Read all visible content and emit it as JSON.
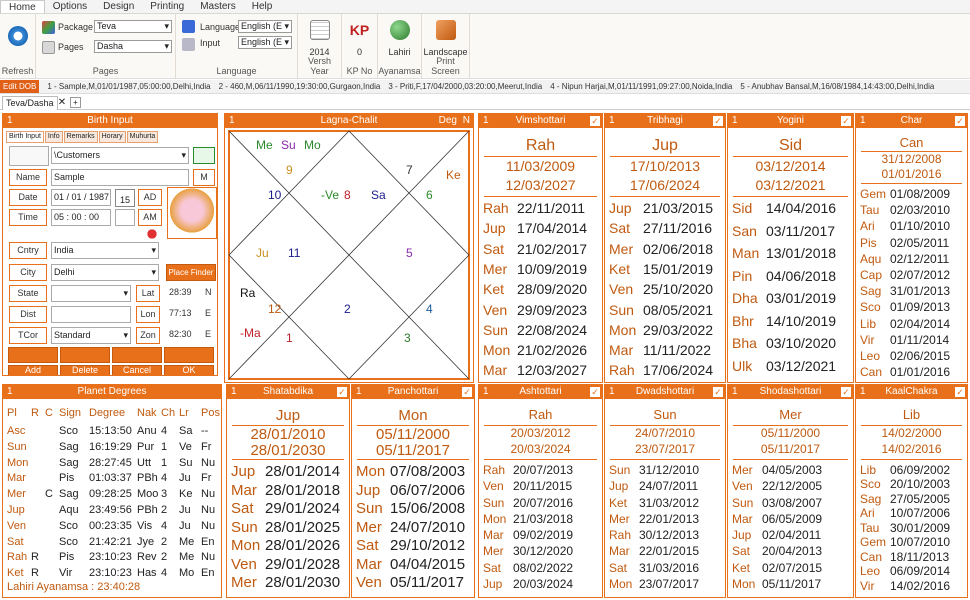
{
  "menu": [
    "Home",
    "Options",
    "Design",
    "Printing",
    "Masters",
    "Help"
  ],
  "ribbon": {
    "refresh": "Refresh",
    "package_label": "Package",
    "package_value": "Teva",
    "pages_label": "Pages",
    "pages_value": "Dasha",
    "pages_group": "Pages",
    "language_label": "Language",
    "language_value": "English (E",
    "input_label": "Input",
    "input_value": "English (E",
    "language_group": "Language",
    "versh_value": "2014",
    "versh_label": "Versh Year",
    "kp_value": "0",
    "kp_label": "KP No",
    "ayanamsa_value": "Lahiri",
    "ayanamsa_label": "Ayanamsa",
    "print_value": "Landscape",
    "print_label": "Print Screen"
  },
  "strip": {
    "edit": "Edit DOB",
    "items": [
      "1 - Sample,M,01/01/1987,05:00:00,Delhi,India",
      "2 - 460,M,06/11/1990,19:30:00,Gurgaon,India",
      "3 - Priti,F,17/04/2000,03:20:00,Meerut,India",
      "4 - Nipun Harjai,M,01/11/1991,09:27:00,Noida,India",
      "5 - Anubhav Bansal,M,16/08/1984,14:43:00,Delhi,India"
    ]
  },
  "tab": {
    "label": "Teva/Dasha",
    "close": "✕",
    "add": "+"
  },
  "birth": {
    "num": "1",
    "title": "Birth Input",
    "subtabs": [
      "Birth Input",
      "Info",
      "Remarks",
      "Horary",
      "Muhurta"
    ],
    "folder": "\\Customers",
    "name_label": "Name",
    "name": "Sample",
    "m": "M",
    "date_label": "Date",
    "date": "01 / 01 / 1987",
    "ad": "AD",
    "time_label": "Time",
    "time": "05 : 00 : 00",
    "am": "AM",
    "cntry_label": "Cntry",
    "cntry": "India",
    "city_label": "City",
    "city": "Delhi",
    "place_finder": "Place Finder",
    "state_label": "State",
    "lat_label": "Lat",
    "lat": "28:39",
    "lat_dir": "N",
    "dist_label": "Dist",
    "lon_label": "Lon",
    "lon": "77:13",
    "lon_dir": "E",
    "tcor_label": "TCor",
    "tcor": "Standard",
    "zon_label": "Zon",
    "zon": "82:30",
    "zon_dir": "E",
    "buttons": [
      "Add",
      "Delete",
      "Cancel",
      "OK"
    ],
    "cal_day": "15"
  },
  "chart": {
    "num": "1",
    "title": "Lagna-Chalit",
    "deg": "Deg",
    "n": "N",
    "labels": [
      {
        "t": "Me",
        "c": "#2a8a2a"
      },
      {
        "t": "Su",
        "c": "#8a2aa8"
      },
      {
        "t": "Mo",
        "c": "#2a8a2a"
      },
      {
        "t": "9",
        "c": "#c89020"
      },
      {
        "t": "7",
        "c": "#333"
      },
      {
        "t": "Ke",
        "c": "#c05a10"
      },
      {
        "t": "10",
        "c": "#1a1a8a"
      },
      {
        "t": "-Ve",
        "c": "#2a8a2a"
      },
      {
        "t": "8",
        "c": "#c0202a"
      },
      {
        "t": "Sa",
        "c": "#1a1a8a"
      },
      {
        "t": "6",
        "c": "#2a8a2a"
      },
      {
        "t": "Ju",
        "c": "#c89020"
      },
      {
        "t": "11",
        "c": "#1a1a8a"
      },
      {
        "t": "5",
        "c": "#8a2aa8"
      },
      {
        "t": "Ra",
        "c": "#111"
      },
      {
        "t": "12",
        "c": "#c05a10"
      },
      {
        "t": "2",
        "c": "#1a1a8a"
      },
      {
        "t": "4",
        "c": "#1a5a9a"
      },
      {
        "t": "-Ma",
        "c": "#c0202a"
      },
      {
        "t": "1",
        "c": "#c0202a"
      },
      {
        "t": "3",
        "c": "#2a7a2a"
      }
    ]
  },
  "top_dashas": [
    {
      "num": "1",
      "title": "Vimshottari",
      "head": "Rah",
      "d1": "11/03/2009",
      "d2": "12/03/2027",
      "rows": [
        [
          "Rah",
          "22/11/2011"
        ],
        [
          "Jup",
          "17/04/2014"
        ],
        [
          "Sat",
          "21/02/2017"
        ],
        [
          "Mer",
          "10/09/2019"
        ],
        [
          "Ket",
          "28/09/2020"
        ],
        [
          "Ven",
          "29/09/2023"
        ],
        [
          "Sun",
          "22/08/2024"
        ],
        [
          "Mon",
          "21/02/2026"
        ],
        [
          "Mar",
          "12/03/2027"
        ]
      ]
    },
    {
      "num": "1",
      "title": "Tribhagi",
      "head": "Jup",
      "d1": "17/10/2013",
      "d2": "17/06/2024",
      "rows": [
        [
          "Jup",
          "21/03/2015"
        ],
        [
          "Sat",
          "27/11/2016"
        ],
        [
          "Mer",
          "02/06/2018"
        ],
        [
          "Ket",
          "15/01/2019"
        ],
        [
          "Ven",
          "25/10/2020"
        ],
        [
          "Sun",
          "08/05/2021"
        ],
        [
          "Mon",
          "29/03/2022"
        ],
        [
          "Mar",
          "11/11/2022"
        ],
        [
          "Rah",
          "17/06/2024"
        ]
      ]
    },
    {
      "num": "1",
      "title": "Yogini",
      "head": "Sid",
      "d1": "03/12/2014",
      "d2": "03/12/2021",
      "rows": [
        [
          "Sid",
          "14/04/2016"
        ],
        [
          "San",
          "03/11/2017"
        ],
        [
          "Man",
          "13/01/2018"
        ],
        [
          "Pin",
          "04/06/2018"
        ],
        [
          "Dha",
          "03/01/2019"
        ],
        [
          "Bhr",
          "14/10/2019"
        ],
        [
          "Bha",
          "03/10/2020"
        ],
        [
          "Ulk",
          "03/12/2021"
        ]
      ]
    }
  ],
  "char": {
    "num": "1",
    "title": "Char",
    "head": "Can",
    "d1": "31/12/2008",
    "d2": "01/01/2016",
    "rows": [
      [
        "Gem",
        "01/08/2009"
      ],
      [
        "Tau",
        "02/03/2010"
      ],
      [
        "Ari",
        "01/10/2010"
      ],
      [
        "Pis",
        "02/05/2011"
      ],
      [
        "Aqu",
        "02/12/2011"
      ],
      [
        "Cap",
        "02/07/2012"
      ],
      [
        "Sag",
        "31/01/2013"
      ],
      [
        "Sco",
        "01/09/2013"
      ],
      [
        "Lib",
        "02/04/2014"
      ],
      [
        "Vir",
        "01/11/2014"
      ],
      [
        "Leo",
        "02/06/2015"
      ],
      [
        "Can",
        "01/01/2016"
      ]
    ]
  },
  "planets": {
    "num": "1",
    "title": "Planet Degrees",
    "headers": [
      "Pl",
      "R",
      "C",
      "Sign",
      "Degree",
      "Nak",
      "Ch",
      "Lr",
      "Pos"
    ],
    "rows": [
      [
        "Asc",
        "",
        "",
        "Sco",
        "15:13:50",
        "Anu",
        "4",
        "Sa",
        "--"
      ],
      [
        "Sun",
        "",
        "",
        "Sag",
        "16:19:29",
        "Pur",
        "1",
        "Ve",
        "Fr"
      ],
      [
        "Mon",
        "",
        "",
        "Sag",
        "28:27:45",
        "Utt",
        "1",
        "Su",
        "Nu"
      ],
      [
        "Mar",
        "",
        "",
        "Pis",
        "01:03:37",
        "PBh",
        "4",
        "Ju",
        "Fr"
      ],
      [
        "Mer",
        "",
        "C",
        "Sag",
        "09:28:25",
        "Moo",
        "3",
        "Ke",
        "Nu"
      ],
      [
        "Jup",
        "",
        "",
        "Aqu",
        "23:49:56",
        "PBh",
        "2",
        "Ju",
        "Nu"
      ],
      [
        "Ven",
        "",
        "",
        "Sco",
        "00:23:35",
        "Vis",
        "4",
        "Ju",
        "Nu"
      ],
      [
        "Sat",
        "",
        "",
        "Sco",
        "21:42:21",
        "Jye",
        "2",
        "Me",
        "En"
      ],
      [
        "Rah",
        "R",
        "",
        "Pis",
        "23:10:23",
        "Rev",
        "2",
        "Me",
        "Nu"
      ],
      [
        "Ket",
        "R",
        "",
        "Vir",
        "23:10:23",
        "Has",
        "4",
        "Mo",
        "En"
      ]
    ],
    "footer": "Lahiri Ayanamsa : 23:40:28"
  },
  "bottom_dashas": [
    {
      "num": "1",
      "title": "Shatabdika",
      "head": "Jup",
      "d1": "28/01/2010",
      "d2": "28/01/2030",
      "rows": [
        [
          "Jup",
          "28/01/2014"
        ],
        [
          "Mar",
          "28/01/2018"
        ],
        [
          "Sat",
          "29/01/2024"
        ],
        [
          "Sun",
          "28/01/2025"
        ],
        [
          "Mon",
          "28/01/2026"
        ],
        [
          "Ven",
          "29/01/2028"
        ],
        [
          "Mer",
          "28/01/2030"
        ]
      ],
      "big": true
    },
    {
      "num": "1",
      "title": "Panchottari",
      "head": "Mon",
      "d1": "05/11/2000",
      "d2": "05/11/2017",
      "rows": [
        [
          "Mon",
          "07/08/2003"
        ],
        [
          "Jup",
          "06/07/2006"
        ],
        [
          "Sun",
          "15/06/2008"
        ],
        [
          "Mer",
          "24/07/2010"
        ],
        [
          "Sat",
          "29/10/2012"
        ],
        [
          "Mar",
          "04/04/2015"
        ],
        [
          "Ven",
          "05/11/2017"
        ]
      ],
      "big": true
    },
    {
      "num": "1",
      "title": "Ashtottari",
      "head": "Rah",
      "d1": "20/03/2012",
      "d2": "20/03/2024",
      "rows": [
        [
          "Rah",
          "20/07/2013"
        ],
        [
          "Ven",
          "20/11/2015"
        ],
        [
          "Sun",
          "20/07/2016"
        ],
        [
          "Mon",
          "21/03/2018"
        ],
        [
          "Mar",
          "09/02/2019"
        ],
        [
          "Mer",
          "30/12/2020"
        ],
        [
          "Sat",
          "08/02/2022"
        ],
        [
          "Jup",
          "20/03/2024"
        ]
      ],
      "big": false
    },
    {
      "num": "1",
      "title": "Dwadshottari",
      "head": "Sun",
      "d1": "24/07/2010",
      "d2": "23/07/2017",
      "rows": [
        [
          "Sun",
          "31/12/2010"
        ],
        [
          "Jup",
          "24/07/2011"
        ],
        [
          "Ket",
          "31/03/2012"
        ],
        [
          "Mer",
          "22/01/2013"
        ],
        [
          "Rah",
          "30/12/2013"
        ],
        [
          "Mar",
          "22/01/2015"
        ],
        [
          "Sat",
          "31/03/2016"
        ],
        [
          "Mon",
          "23/07/2017"
        ]
      ],
      "big": false
    },
    {
      "num": "1",
      "title": "Shodashottari",
      "head": "Mer",
      "d1": "05/11/2000",
      "d2": "05/11/2017",
      "rows": [
        [
          "Mer",
          "04/05/2003"
        ],
        [
          "Ven",
          "22/12/2005"
        ],
        [
          "Sun",
          "03/08/2007"
        ],
        [
          "Mar",
          "06/05/2009"
        ],
        [
          "Jup",
          "02/04/2011"
        ],
        [
          "Sat",
          "20/04/2013"
        ],
        [
          "Ket",
          "02/07/2015"
        ],
        [
          "Mon",
          "05/11/2017"
        ]
      ],
      "big": false
    },
    {
      "num": "1",
      "title": "KaalChakra",
      "head": "Lib",
      "d1": "14/02/2000",
      "d2": "14/02/2016",
      "rows": [
        [
          "Lib",
          "06/09/2002"
        ],
        [
          "Sco",
          "20/10/2003"
        ],
        [
          "Sag",
          "27/05/2005"
        ],
        [
          "Ari",
          "10/07/2006"
        ],
        [
          "Tau",
          "30/01/2009"
        ],
        [
          "Gem",
          "10/07/2010"
        ],
        [
          "Can",
          "18/11/2013"
        ],
        [
          "Leo",
          "06/09/2014"
        ],
        [
          "Vir",
          "14/02/2016"
        ]
      ],
      "big": false
    }
  ],
  "colors": {
    "accent": "#e8701a",
    "accent_dark": "#c05a10"
  }
}
